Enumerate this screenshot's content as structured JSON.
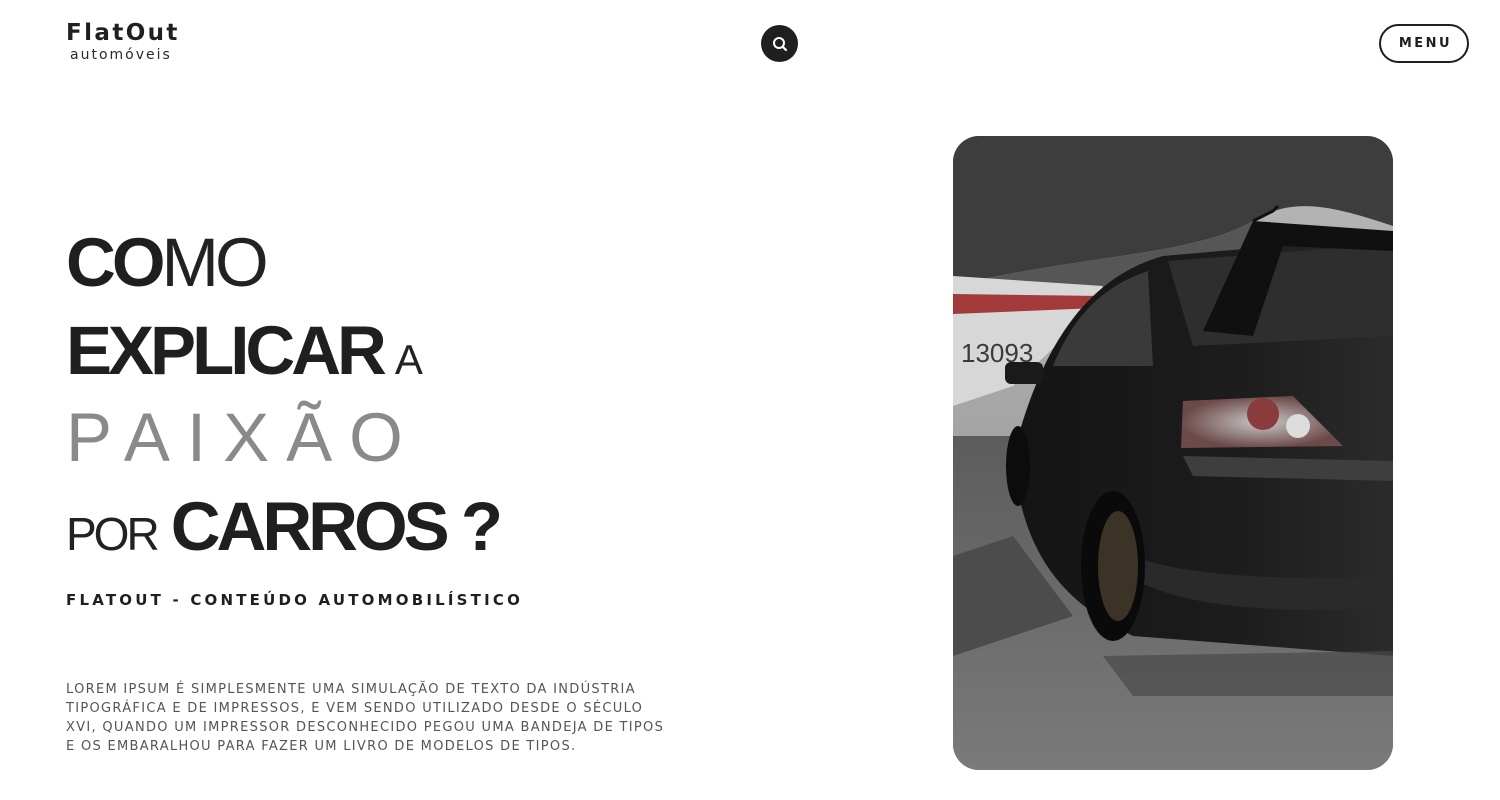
{
  "brand": {
    "name": "FlatOut",
    "tagline": "automóveis"
  },
  "header": {
    "search_icon": "search-icon",
    "menu_label": "MENU"
  },
  "hero": {
    "line1_bold": "CO",
    "line1_regular": "MO",
    "line2_bold": "EXPLICAR",
    "line2_small": "A",
    "line3": "PAIXÃO",
    "line4_small": "POR",
    "line4_bold": "CARROS ?",
    "subtitle": "FLATOUT - CONTEÚDO AUTOMOBILÍSTICO",
    "body_lines": [
      "LOREM IPSUM É SIMPLESMENTE UMA SIMULAÇÃO DE TEXTO DA INDÚSTRIA",
      "TIPOGRÁFICA E DE IMPRESSOS, E VEM SENDO UTILIZADO DESDE O SÉCULO",
      "XVI, QUANDO UM IMPRESSOR DESCONHECIDO PEGOU UMA BANDEJA DE TIPOS",
      "E OS EMBARALHOU PARA FAZER UM LIVRO DE MODELOS DE TIPOS."
    ]
  },
  "photo": {
    "subject": "black sedan rear view with wing spoiler, parked on wet road",
    "boat_text": "13093"
  },
  "colors": {
    "text_dark": "#1f1f1f",
    "text_grey": "#8a8a8a",
    "body_grey": "#555555",
    "background": "#ffffff"
  }
}
